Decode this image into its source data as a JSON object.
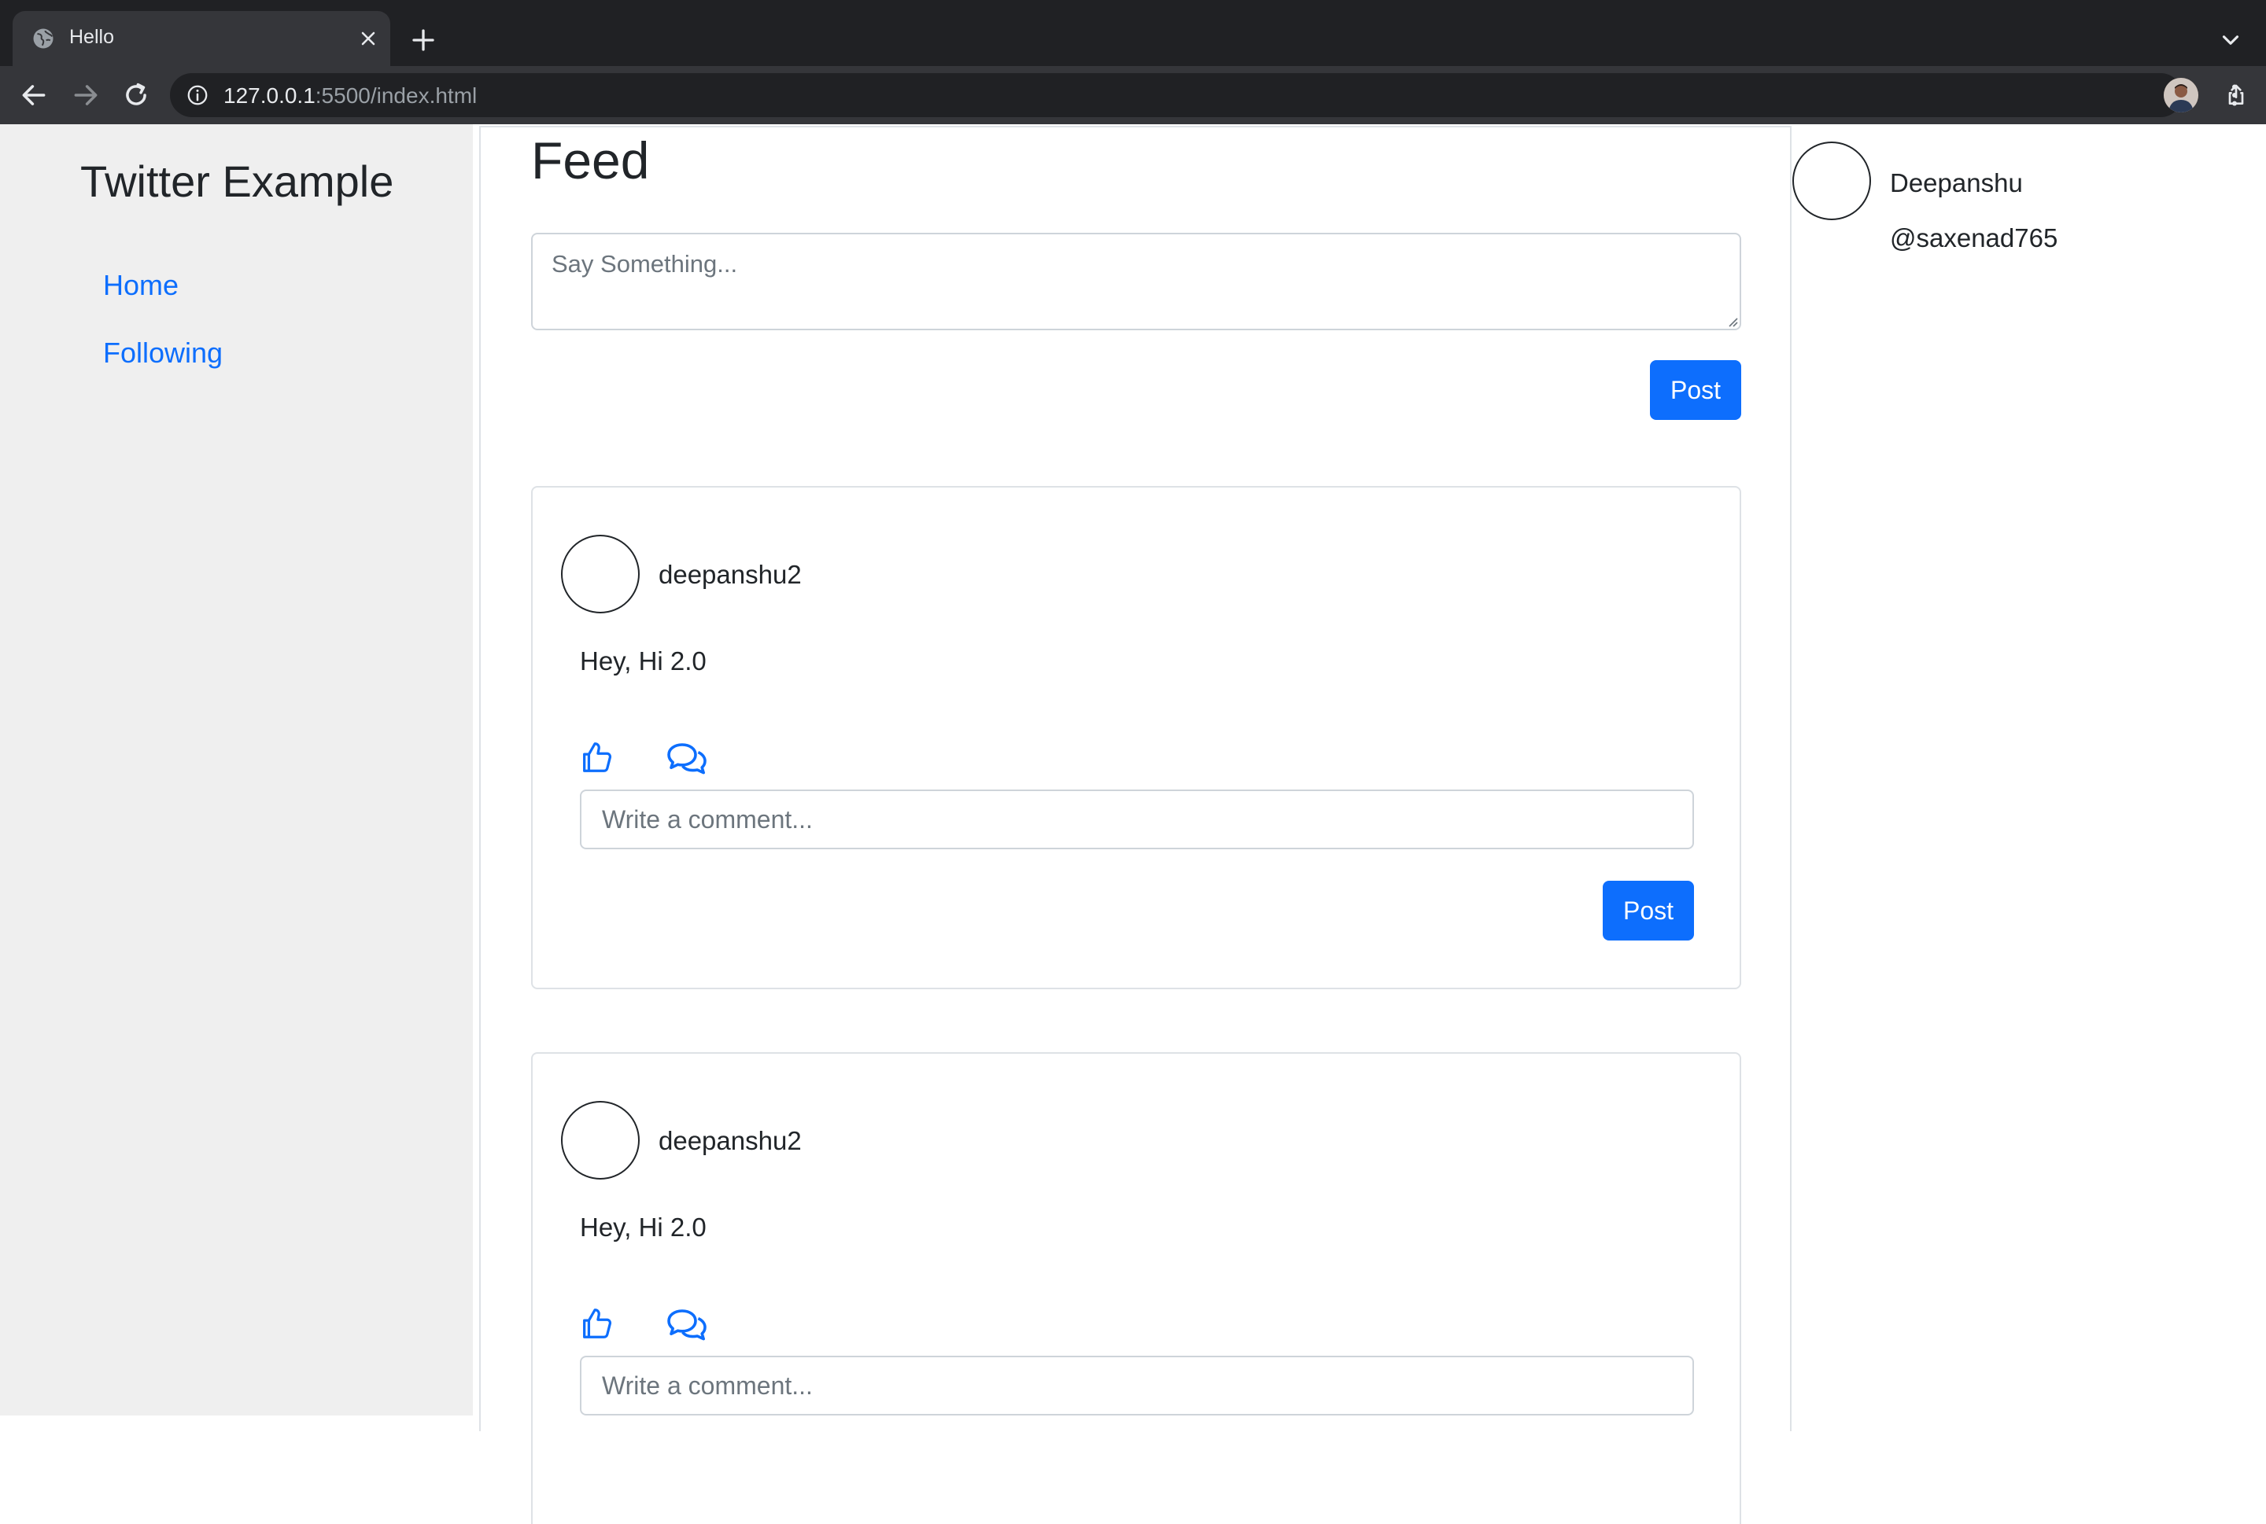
{
  "browser": {
    "tab_title": "Hello",
    "url_host": "127.0.0.1",
    "url_rest": ":5500/index.html"
  },
  "colors": {
    "accent": "#0d6efd",
    "sidebar_bg": "#efefef",
    "chrome_dark": "#202124",
    "chrome_toolbar": "#35363a"
  },
  "sidebar": {
    "brand": "Twitter Example",
    "items": [
      {
        "label": "Home"
      },
      {
        "label": "Following"
      }
    ]
  },
  "feed": {
    "title": "Feed",
    "compose_placeholder": "Say Something...",
    "post_button": "Post"
  },
  "posts": [
    {
      "username": "deepanshu2",
      "text": "Hey, Hi 2.0",
      "comment_placeholder": "Write a comment...",
      "comment_button": "Post"
    },
    {
      "username": "deepanshu2",
      "text": "Hey, Hi 2.0",
      "comment_placeholder": "Write a comment..."
    }
  ],
  "profile": {
    "name": "Deepanshu",
    "handle": "@saxenad765"
  },
  "icons": [
    "globe-icon",
    "close-icon",
    "plus-icon",
    "chevron-down-icon",
    "back-arrow-icon",
    "forward-arrow-icon",
    "reload-icon",
    "info-icon",
    "share-icon",
    "star-icon",
    "kebab-menu-icon",
    "thumbs-up-icon",
    "chat-bubbles-icon"
  ]
}
